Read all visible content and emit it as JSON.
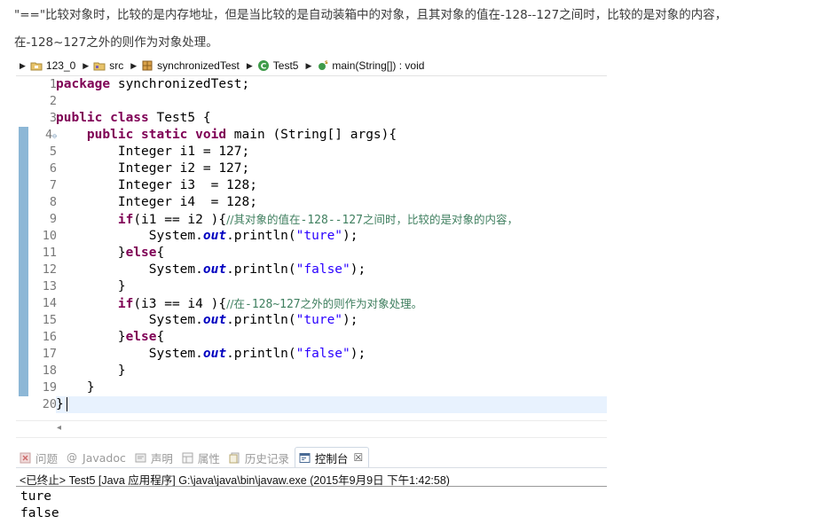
{
  "intro": {
    "line1": "\"==\"比较对象时，比较的是内存地址，但是当比较的是自动装箱中的对象，且其对象的值在-128--127之间时，比较的是对象的内容，",
    "line2": "在-128~127之外的则作为对象处理。"
  },
  "breadcrumb": {
    "items": [
      {
        "label": "123_0",
        "icon": "project-icon"
      },
      {
        "label": "src",
        "icon": "source-folder-icon"
      },
      {
        "label": "synchronizedTest",
        "icon": "package-icon"
      },
      {
        "label": "Test5",
        "icon": "class-icon"
      },
      {
        "label": "main(String[]) : void",
        "icon": "method-icon"
      }
    ]
  },
  "editor": {
    "line_numbers": [
      "1",
      "2",
      "3",
      "4",
      "5",
      "6",
      "7",
      "8",
      "9",
      "10",
      "11",
      "12",
      "13",
      "14",
      "15",
      "16",
      "17",
      "18",
      "19",
      "20"
    ],
    "tokens": {
      "pkg_kw": "package",
      "pkg_name": " synchronizedTest;",
      "class_kw": "public class",
      "class_name": " Test5 {",
      "main_indent": "    ",
      "main_kw": "public static void",
      "main_rest": " main (String[] args){",
      "i1": "        Integer i1 = 127;",
      "i2": "        Integer i2 = 127;",
      "i3": "        Integer i3  = 128;",
      "i4": "        Integer i4  = 128;",
      "if1_indent": "        ",
      "if_kw": "if",
      "if1_cond": "(i1 == i2 ){",
      "if1_comment_a": "//其对象的值在",
      "if1_comment_b": "-128--127",
      "if1_comment_c": "之间时，比较的是对象的内容，",
      "print_indent": "            ",
      "print_sys": "System.",
      "print_out": "out",
      "print_call": ".println(",
      "str_ture": "\"ture\"",
      "str_false": "\"false\"",
      "print_end": ");",
      "else_close": "        }",
      "else_kw": "else",
      "else_open": "{",
      "if2_cond": "(i3 == i4 ){",
      "if2_comment_a": "//在",
      "if2_comment_b": "-128~127",
      "if2_comment_c": "之外的则作为对象处理。",
      "close_inner": "        }",
      "close_method": "    }",
      "close_class": "}"
    }
  },
  "views": {
    "tabs": [
      {
        "label": "问题",
        "icon": "problems-icon"
      },
      {
        "label": "Javadoc",
        "icon": "javadoc-icon"
      },
      {
        "label": "声明",
        "icon": "declaration-icon"
      },
      {
        "label": "属性",
        "icon": "properties-icon"
      },
      {
        "label": "历史记录",
        "icon": "history-icon"
      },
      {
        "label": "控制台",
        "icon": "console-icon"
      }
    ],
    "close_glyph": "☒",
    "console_status": "<已终止> Test5 [Java 应用程序] G:\\java\\java\\bin\\javaw.exe (2015年9月9日 下午1:42:58)",
    "console_output": [
      "ture",
      "false"
    ]
  },
  "colors": {
    "keyword": "#7f0055",
    "string": "#2a00ff",
    "field": "#0000c0",
    "comment": "#3f7f5f",
    "current_line": "#e8f2fe",
    "marker": "#8db7d6"
  }
}
